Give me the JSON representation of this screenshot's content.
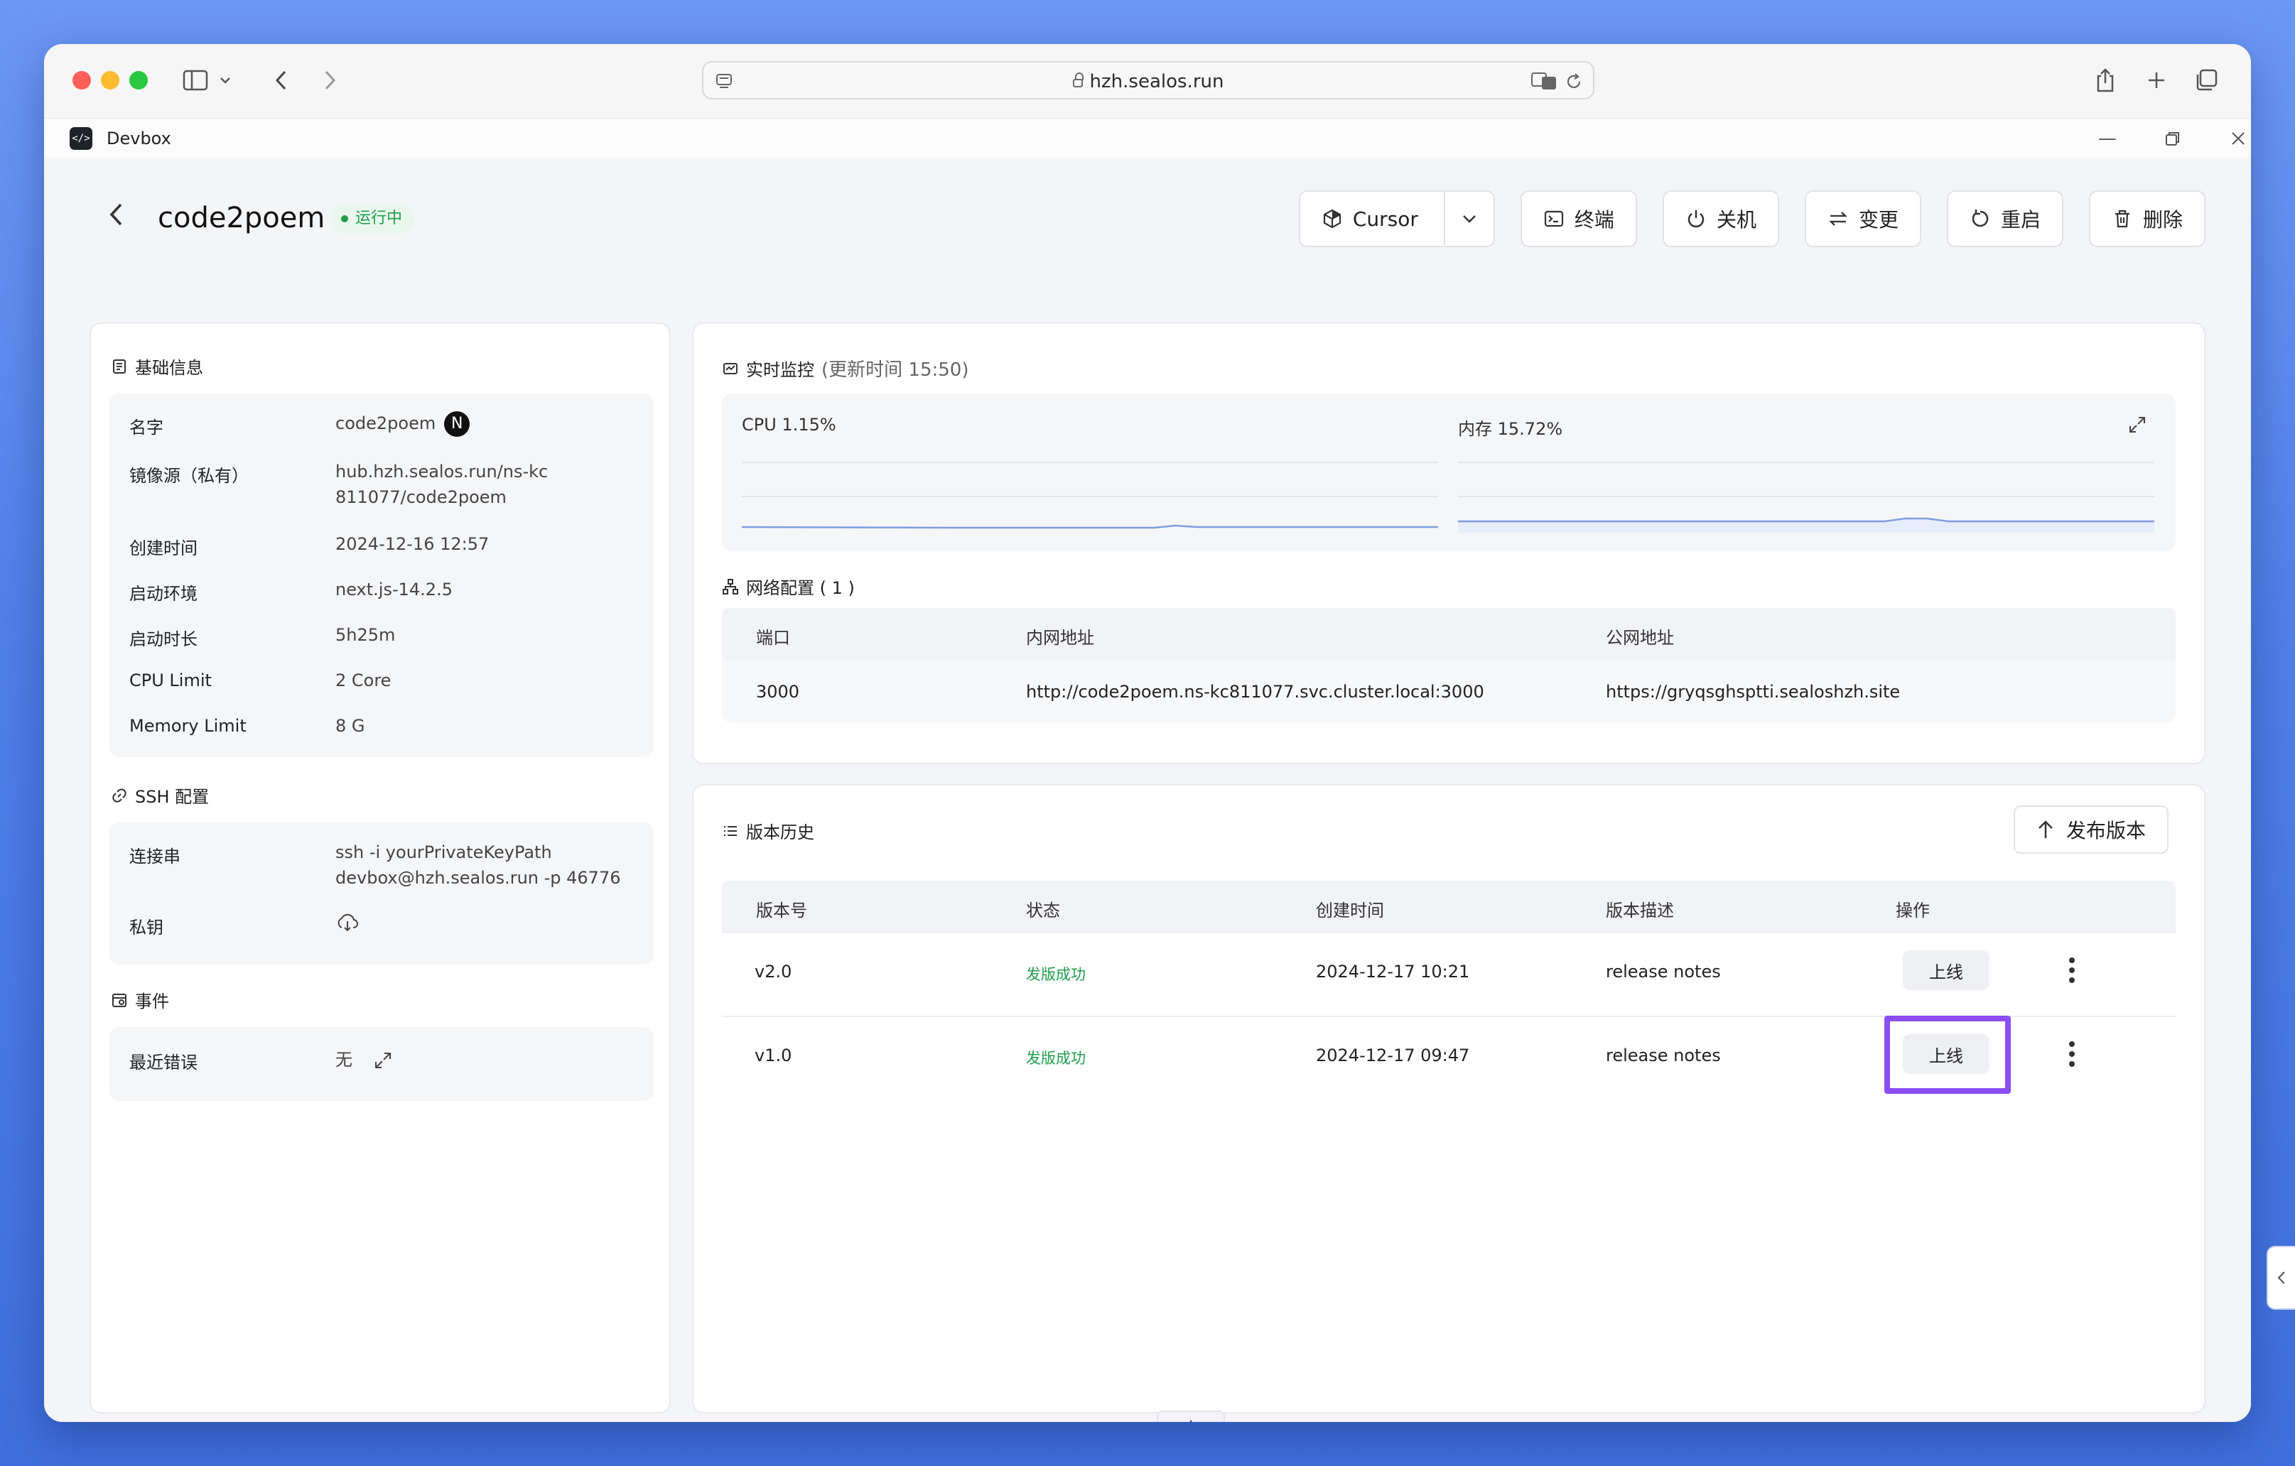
{
  "browser": {
    "url": "hzh.sealos.run"
  },
  "app": {
    "name": "Devbox"
  },
  "header": {
    "title": "code2poem",
    "status": "运行中",
    "actions": {
      "cursor": "Cursor",
      "terminal": "终端",
      "shutdown": "关机",
      "change": "变更",
      "restart": "重启",
      "delete": "删除"
    }
  },
  "basic_info": {
    "title": "基础信息",
    "rows": [
      {
        "key": "名字",
        "value": "code2poem"
      },
      {
        "key": "镜像源（私有）",
        "value": "hub.hzh.sealos.run/ns-kc811077/code2poem"
      },
      {
        "key": "创建时间",
        "value": "2024-12-16 12:57"
      },
      {
        "key": "启动环境",
        "value": "next.js-14.2.5"
      },
      {
        "key": "启动时长",
        "value": "5h25m"
      },
      {
        "key": "CPU Limit",
        "value": "2 Core"
      },
      {
        "key": "Memory Limit",
        "value": "8 G"
      }
    ],
    "name_badge": "N"
  },
  "ssh": {
    "title": "SSH 配置",
    "conn_key": "连接串",
    "conn_value": "ssh -i yourPrivateKeyPath devbox@hzh.sealos.run -p 46776",
    "private_key": "私钥"
  },
  "events": {
    "title": "事件",
    "recent_error_key": "最近错误",
    "recent_error_value": "无"
  },
  "monitor": {
    "title": "实时监控",
    "updated": "(更新时间  15:50)",
    "cpu_label": "CPU 1.15%",
    "mem_label": "内存 15.72%",
    "accent": "#6f8fd8"
  },
  "network": {
    "title": "网络配置 ( 1 )",
    "headers": [
      "端口",
      "内网地址",
      "公网地址"
    ],
    "rows": [
      {
        "port": "3000",
        "internal": "http://code2poem.ns-kc811077.svc.cluster.local:3000",
        "public": "https://gryqsghsptti.sealoshzh.site"
      }
    ]
  },
  "versions": {
    "title": "版本历史",
    "publish_label": "发布版本",
    "headers": [
      "版本号",
      "状态",
      "创建时间",
      "版本描述",
      "操作"
    ],
    "rows": [
      {
        "version": "v2.0",
        "status": "发版成功",
        "created": "2024-12-17 10:21",
        "desc": "release notes",
        "action": "上线"
      },
      {
        "version": "v1.0",
        "status": "发版成功",
        "created": "2024-12-17 09:47",
        "desc": "release notes",
        "action": "上线"
      }
    ],
    "highlight_color": "#8a4ef2"
  }
}
